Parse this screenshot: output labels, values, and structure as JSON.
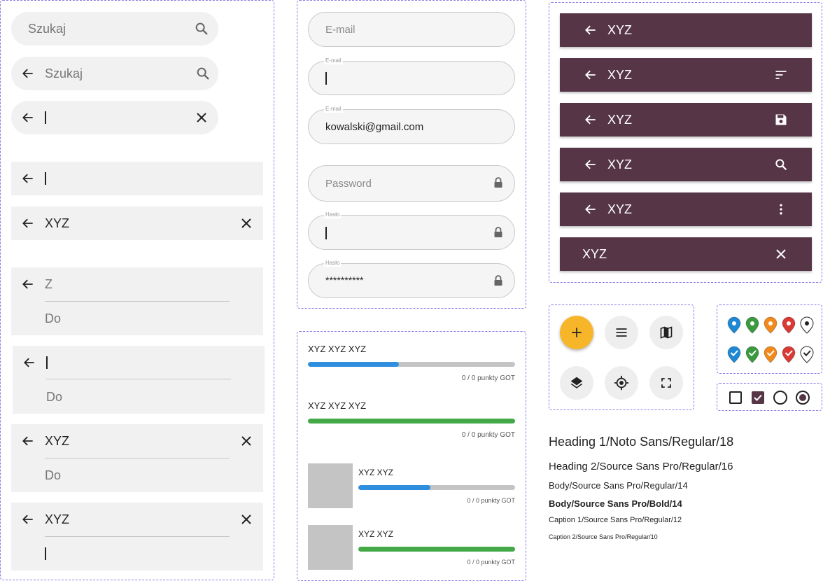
{
  "search": {
    "placeholder": "Szukaj",
    "value": "XYZ",
    "from_placeholder": "Z",
    "to_placeholder": "Do"
  },
  "form": {
    "email_placeholder": "E-mail",
    "email_label": "E-mail",
    "email_value": "kowalski@gmail.com",
    "password_placeholder": "Password",
    "password_label": "Hasło",
    "password_value": "**********"
  },
  "progress": {
    "title": "XYZ XYZ XYZ",
    "small_title": "XYZ XYZ",
    "caption": "0 / 0 punkty GOT",
    "items": [
      {
        "fraction": 0.44,
        "color": "#2f8fde"
      },
      {
        "fraction": 1.0,
        "color": "#43a947"
      },
      {
        "fraction": 0.46,
        "color": "#2f8fde"
      },
      {
        "fraction": 1.0,
        "color": "#43a947"
      }
    ]
  },
  "appbars": {
    "title": "XYZ"
  },
  "markers": {
    "colors": [
      "#1e88d4",
      "#3b9a3f",
      "#f28a1b",
      "#d93a34",
      "#ffffff"
    ]
  },
  "typography": {
    "h1": "Heading 1/Noto Sans/Regular/18",
    "h2": "Heading 2/Source Sans Pro/Regular/16",
    "body": "Body/Source Sans Pro/Regular/14",
    "body_bold": "Body/Source Sans Pro/Bold/14",
    "caption1": "Caption 1/Source Sans Pro/Regular/12",
    "caption2": "Caption 2/Source Sans Pro/Regular/10"
  },
  "colors": {
    "appbar": "#553546",
    "fab": "#f7b52a",
    "frame": "#8b79e6"
  }
}
